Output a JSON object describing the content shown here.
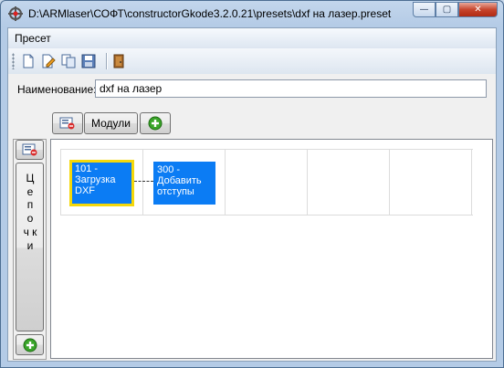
{
  "window": {
    "title": "D:\\ARMlaser\\СОФТ\\constructorGkode3.2.0.21\\presets\\dxf на лазер.preset",
    "buttons": {
      "minimize": "—",
      "maximize": "▢",
      "close": "✕"
    }
  },
  "menu": {
    "items": [
      "Пресет"
    ]
  },
  "toolbar": {
    "buttons": [
      "new-file-icon",
      "edit-file-icon",
      "copy-file-icon",
      "save-file-icon",
      "exit-door-icon"
    ]
  },
  "form": {
    "name_label": "Наименование:",
    "name_value": "dxf на лазер"
  },
  "top_buttons": {
    "modules_label": "Модули"
  },
  "side": {
    "chains_label": "Ц е п о ч к и"
  },
  "blocks": [
    {
      "text": "101 - Загрузка DXF",
      "selected": true
    },
    {
      "text": "300 - Добавить отступы",
      "selected": false
    }
  ],
  "colors": {
    "block_fill": "#0b7cf4",
    "selected_border": "#f5d80a",
    "add_green": "#3aa52a"
  }
}
